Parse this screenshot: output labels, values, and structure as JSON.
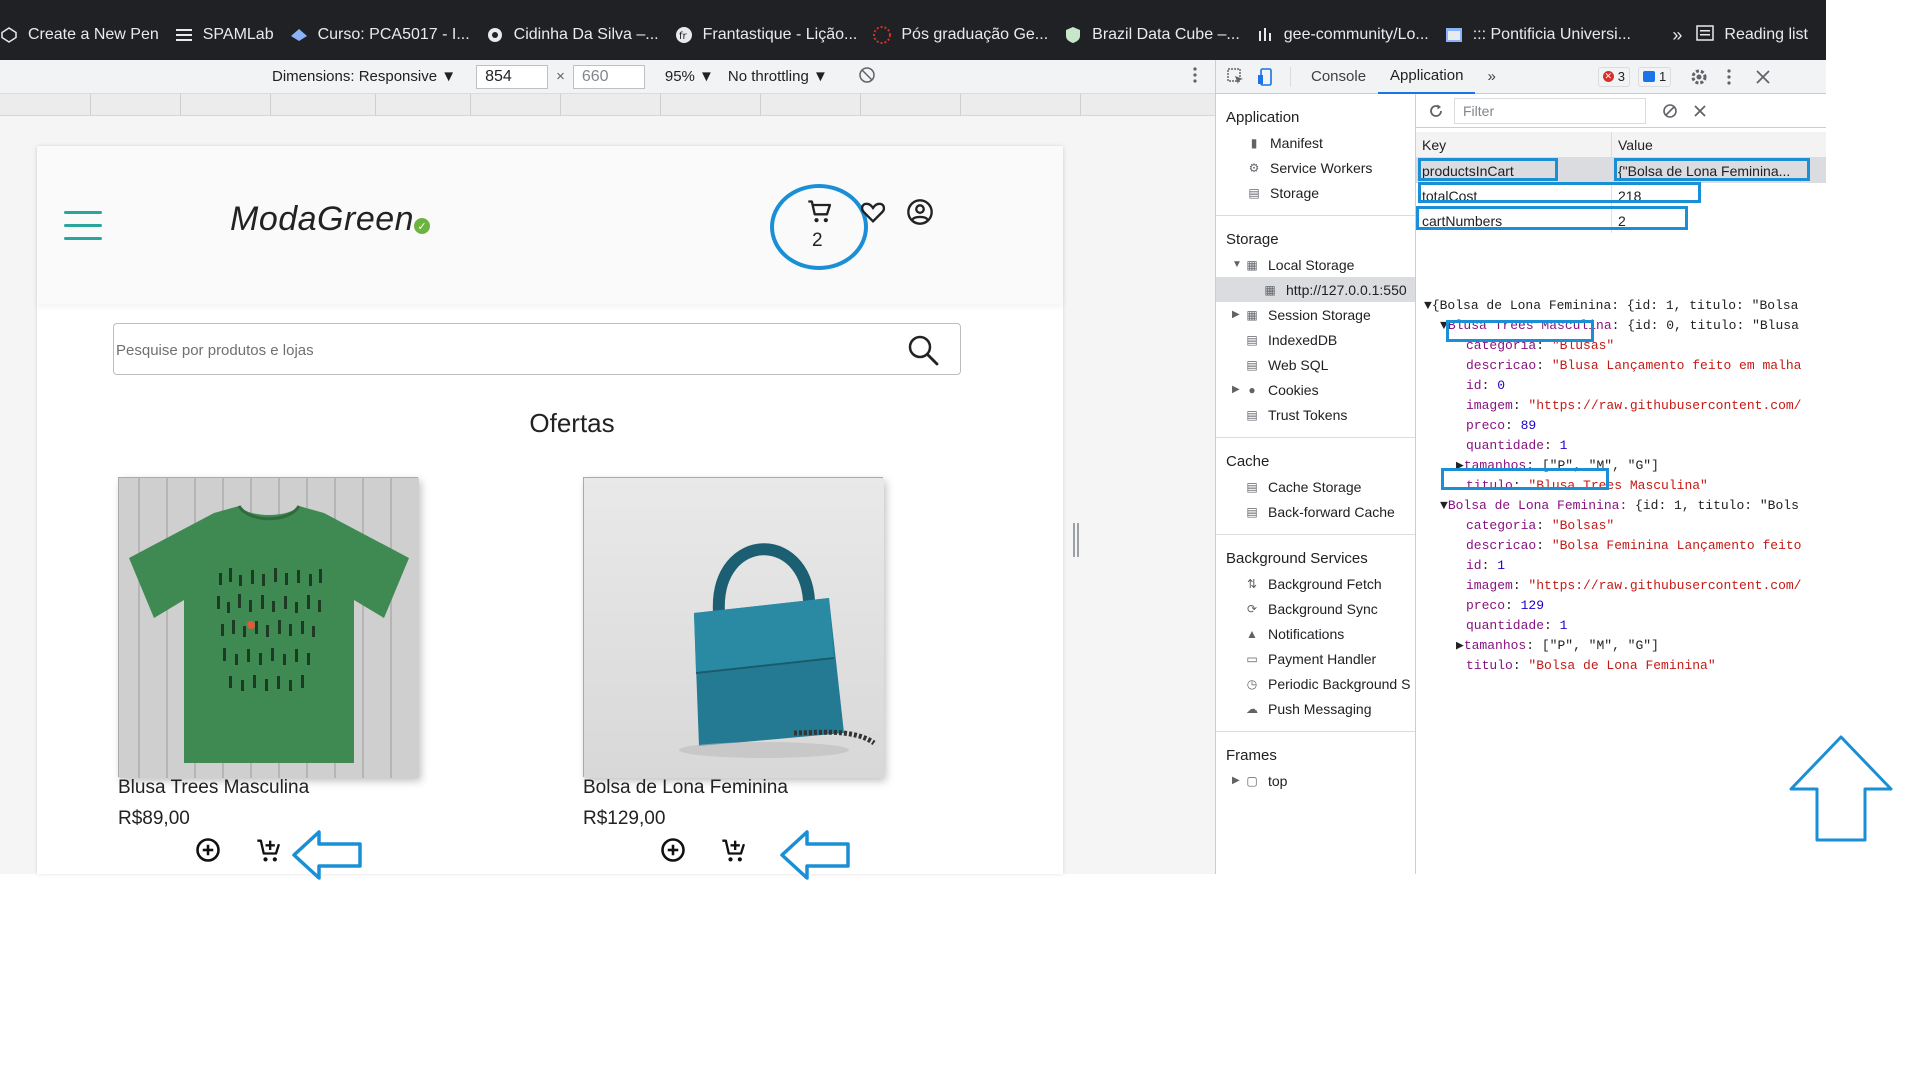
{
  "browser": {
    "bookmarks": [
      {
        "label": "Create a New Pen",
        "icon": "codepen-icon"
      },
      {
        "label": "SPAMLab",
        "icon": "list-icon"
      },
      {
        "label": "Curso: PCA5017 - I...",
        "icon": "moodle-icon"
      },
      {
        "label": "Cidinha Da Silva –...",
        "icon": "globe-icon"
      },
      {
        "label": "Frantastique - Lição...",
        "icon": "fr-icon"
      },
      {
        "label": "Pós graduação Ge...",
        "icon": "dots-icon"
      },
      {
        "label": "Brazil Data Cube –...",
        "icon": "shield-icon"
      },
      {
        "label": "gee-community/Lo...",
        "icon": "bars-icon"
      },
      {
        "label": "::: Pontificia Universi...",
        "icon": "window-icon"
      }
    ],
    "more_label": "»",
    "reading_list_label": "Reading list"
  },
  "device_toolbar": {
    "dimensions_label": "Dimensions: Responsive ▼",
    "width": "854",
    "height": "660",
    "times": "×",
    "zoom": "95% ▼",
    "throttle": "No throttling ▼"
  },
  "site": {
    "logo": "ModaGreen",
    "cart_count": "2",
    "search_placeholder": "Pesquise por produtos e lojas",
    "offers_title": "Ofertas",
    "products": [
      {
        "name": "Blusa Trees Masculina",
        "price": "R$89,00"
      },
      {
        "name": "Bolsa de Lona Feminina",
        "price": "R$129,00"
      }
    ],
    "colors": {
      "accent": "#2aa59b",
      "highlight": "#1a8fd6"
    }
  },
  "devtools": {
    "tabs": [
      "Console",
      "Application"
    ],
    "active_tab": "Application",
    "more": "»",
    "error_count": "3",
    "message_count": "1",
    "sidebar": {
      "application_header": "Application",
      "application_items": [
        "Manifest",
        "Service Workers",
        "Storage"
      ],
      "storage_header": "Storage",
      "local_storage": "Local Storage",
      "local_origin": "http://127.0.0.1:550",
      "storage_items": [
        "Session Storage",
        "IndexedDB",
        "Web SQL",
        "Cookies",
        "Trust Tokens"
      ],
      "cache_header": "Cache",
      "cache_items": [
        "Cache Storage",
        "Back-forward Cache"
      ],
      "bg_header": "Background Services",
      "bg_items": [
        "Background Fetch",
        "Background Sync",
        "Notifications",
        "Payment Handler",
        "Periodic Background S",
        "Push Messaging"
      ],
      "frames_header": "Frames",
      "frames_item": "top"
    },
    "filter_placeholder": "Filter",
    "table": {
      "key_header": "Key",
      "value_header": "Value",
      "rows": [
        {
          "key": "productsInCart",
          "value": "{\"Bolsa de Lona Feminina..."
        },
        {
          "key": "totalCost",
          "value": "218"
        },
        {
          "key": "cartNumbers",
          "value": "2"
        }
      ]
    },
    "tree": {
      "root": "{Bolsa de Lona Feminina: {id: 1, titulo: \"Bolsa",
      "item1_key": "Blusa Trees Masculina",
      "item1_summary": ": {id: 0, titulo: \"Blusa",
      "item1_fields": [
        {
          "k": "categoria",
          "v": "\"Blusas\"",
          "t": "s"
        },
        {
          "k": "descricao",
          "v": "\"Blusa Lançamento feito em malha",
          "t": "s"
        },
        {
          "k": "id",
          "v": "0",
          "t": "n"
        },
        {
          "k": "imagem",
          "v": "\"https://raw.githubusercontent.com/",
          "t": "s"
        },
        {
          "k": "preco",
          "v": "89",
          "t": "n"
        },
        {
          "k": "quantidade",
          "v": "1",
          "t": "n"
        },
        {
          "k": "tamanhos",
          "v": "[\"P\", \"M\", \"G\"]",
          "t": "p"
        },
        {
          "k": "titulo",
          "v": "\"Blusa Trees Masculina\"",
          "t": "s"
        }
      ],
      "item2_key": "Bolsa de Lona Feminina:",
      "item2_summary": " {id: 1, titulo: \"Bols",
      "item2_fields": [
        {
          "k": "categoria",
          "v": "\"Bolsas\"",
          "t": "s"
        },
        {
          "k": "descricao",
          "v": "\"Bolsa Feminina Lançamento feito",
          "t": "s"
        },
        {
          "k": "id",
          "v": "1",
          "t": "n"
        },
        {
          "k": "imagem",
          "v": "\"https://raw.githubusercontent.com/",
          "t": "s"
        },
        {
          "k": "preco",
          "v": "129",
          "t": "n"
        },
        {
          "k": "quantidade",
          "v": "1",
          "t": "n"
        },
        {
          "k": "tamanhos",
          "v": "[\"P\", \"M\", \"G\"]",
          "t": "p"
        },
        {
          "k": "titulo",
          "v": "\"Bolsa de Lona Feminina\"",
          "t": "s"
        }
      ]
    }
  }
}
